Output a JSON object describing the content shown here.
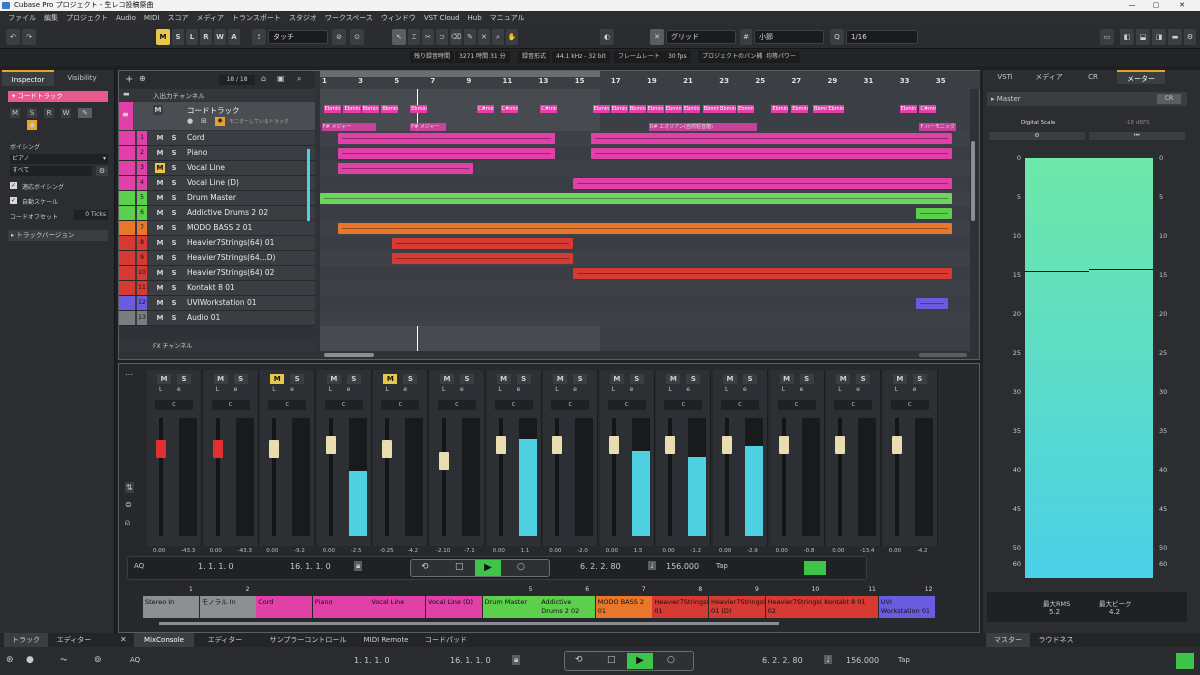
{
  "title_bar": {
    "text": "Cubase Pro プロジェクト - 生レコ投稿祭曲"
  },
  "menu": [
    "ファイル",
    "編集",
    "プロジェクト",
    "Audio",
    "MIDI",
    "スコア",
    "メディア",
    "トランスポート",
    "スタジオ",
    "ワークスペース",
    "ウィンドウ",
    "VST Cloud",
    "Hub",
    "マニュアル"
  ],
  "toolbar": {
    "m": "M",
    "s": "S",
    "l": "L",
    "r": "R",
    "w": "W",
    "a": "A",
    "automation_mode": "タッチ",
    "snap_type": "グリッド",
    "grid": "小節",
    "quantize": "1/16"
  },
  "status": {
    "rec_time_label": "残り録音時間",
    "rec_time": "3271 時間 31 分",
    "rec_format_label": "録音形式",
    "rec_format": "44.1 kHz - 32 bit",
    "frame_rate_label": "フレームレート",
    "frame_rate": "30 fps",
    "pan_law_label": "プロジェクトのパン補正",
    "pan_law": "均等パワー"
  },
  "inspector": {
    "tab_inspector": "Inspector",
    "tab_visibility": "Visibility",
    "section": "コードトラック",
    "voicing_label": "ボイシング",
    "voicing": "ピアノ",
    "voicing_sub": "すべて",
    "adaptive_voicing": "適応ボイシング",
    "auto_scale": "自動スケール",
    "offset_label": "コードオフセット",
    "offset": "0 Ticks",
    "track_versions": "トラックバージョン"
  },
  "project": {
    "counter": "18 / 18",
    "input_channel": "入出力チャンネル",
    "chord_track": "コードトラック",
    "chord_monitor": "モニターしているトラック",
    "fx_channel": "FX チャンネル",
    "ruler": [
      "1",
      "3",
      "5",
      "7",
      "9",
      "11",
      "13",
      "15",
      "17",
      "19",
      "21",
      "23",
      "25",
      "27",
      "29",
      "31",
      "33",
      "35"
    ],
    "chords_row1": [
      "Ebmin",
      "Ebmin",
      "Bbmin",
      "Bbmin",
      "Ebmin",
      "C#min",
      "C#min",
      "C#min",
      "Ebmin",
      "Ebmin",
      "Bbmin",
      "Ebmin",
      "Ebmin",
      "Ebmin",
      "Bbmin",
      "Bbmin",
      "Ebmin",
      "Ebmin",
      "Ebmin",
      "Bbmin",
      "Ebmin",
      "Ebmin",
      "C#min"
    ],
    "scales": [
      "F# メジャー",
      "F# メジャー",
      "D# エオリアン(自然短音階)",
      "F ハーモニック"
    ],
    "tracks": [
      {
        "num": "1",
        "name": "Cord",
        "color": "#e040a8"
      },
      {
        "num": "2",
        "name": "Piano",
        "color": "#e040a8"
      },
      {
        "num": "3",
        "name": "Vocal Line",
        "color": "#e040a8"
      },
      {
        "num": "4",
        "name": "Vocal Line (D)",
        "color": "#e040a8"
      },
      {
        "num": "5",
        "name": "Drum Master",
        "color": "#5ccf4c"
      },
      {
        "num": "6",
        "name": "Addictive Drums 2 02",
        "color": "#5ccf4c"
      },
      {
        "num": "7",
        "name": "MODO BASS 2 01",
        "color": "#e8772c"
      },
      {
        "num": "8",
        "name": "Heavier7Strings(64) 01",
        "color": "#d63a32"
      },
      {
        "num": "9",
        "name": "Heavier7Strings(64...D)",
        "color": "#d63a32"
      },
      {
        "num": "10",
        "name": "Heavier7Strings(64) 02",
        "color": "#d63a32"
      },
      {
        "num": "11",
        "name": "Kontakt 8 01",
        "color": "#d63a32"
      },
      {
        "num": "12",
        "name": "UVIWorkstation 01",
        "color": "#6a5ce0"
      },
      {
        "num": "13",
        "name": "Audio 01",
        "color": "#7a7d82"
      }
    ]
  },
  "mixer": {
    "channels": [
      {
        "num": "1",
        "name": "Stereo In",
        "color": "#8c8f93",
        "val1": "0.00",
        "val2": "-43.3",
        "meter": 0.0
      },
      {
        "num": "2",
        "name": "モノラル In",
        "color": "#8c8f93",
        "val1": "0.00",
        "val2": "-43.3",
        "meter": 0.0
      },
      {
        "num": "",
        "name": "Cord",
        "color": "#e040a8",
        "val1": "0.00",
        "val2": "-9.2",
        "meter": 0.0
      },
      {
        "num": "",
        "name": "Piano",
        "color": "#e040a8",
        "val1": "0.00",
        "val2": "-2.5",
        "meter": 0.55
      },
      {
        "num": "",
        "name": "Vocal Line",
        "color": "#e040a8",
        "val1": "-0.25",
        "val2": "-4.2",
        "meter": 0.0
      },
      {
        "num": "",
        "name": "Vocal Line (D)",
        "color": "#e040a8",
        "val1": "-2.10",
        "val2": "-7.1",
        "meter": 0.0
      },
      {
        "num": "5",
        "name": "Drum Master",
        "color": "#5ccf4c",
        "val1": "0.00",
        "val2": "1.1",
        "meter": 0.82
      },
      {
        "num": "6",
        "name": "Addictive Drums 2 02",
        "color": "#5ccf4c",
        "val1": "0.00",
        "val2": "-2.0",
        "meter": 0.0
      },
      {
        "num": "7",
        "name": "MODO BASS 2 01",
        "color": "#e8772c",
        "val1": "0.00",
        "val2": "1.5",
        "meter": 0.72
      },
      {
        "num": "8",
        "name": "Heavier7Strings(64) 01",
        "color": "#d63a32",
        "val1": "0.00",
        "val2": "-1.2",
        "meter": 0.67
      },
      {
        "num": "9",
        "name": "Heavier7Strings(64) 01 (D)",
        "color": "#d63a32",
        "val1": "0.00",
        "val2": "-2.9",
        "meter": 0.76
      },
      {
        "num": "10",
        "name": "Heavier7Strings(64) 02",
        "color": "#d63a32",
        "val1": "0.00",
        "val2": "-0.8",
        "meter": 0.0
      },
      {
        "num": "11",
        "name": "Kontakt 8 01",
        "color": "#d63a32",
        "val1": "0.00",
        "val2": "-13.4",
        "meter": 0.0
      },
      {
        "num": "12",
        "name": "UVI Workstation 01",
        "color": "#6a5ce0",
        "val1": "0.00",
        "val2": "-4.2",
        "meter": 0.0
      }
    ],
    "transport": {
      "aq": "AQ",
      "left": "1. 1. 1.  0",
      "right": "16. 1. 1.  0",
      "pos": "6. 2. 2. 80",
      "tempo": "156.000",
      "tap": "Tap"
    }
  },
  "right_panel": {
    "tabs": [
      "VSTi",
      "メディア",
      "CR",
      "メーター"
    ],
    "master": "Master",
    "cr": "CR",
    "scale": "Digital Scale",
    "ref": "-18 dBFS",
    "ticks": [
      "0",
      "5",
      "10",
      "15",
      "20",
      "25",
      "30",
      "35",
      "40",
      "45",
      "50",
      "60"
    ],
    "max_rms_label": "最大RMS",
    "max_rms": "5.2",
    "max_peak_label": "最大ピーク",
    "max_peak": "4.2",
    "bottom_tabs": [
      "マスター",
      "ラウドネス"
    ]
  },
  "bottom_tabs": [
    "トラック",
    "エディター",
    "MixConsole",
    "エディター",
    "サンプラーコントロール",
    "MIDI Remote",
    "コードパッド"
  ],
  "transport": {
    "aq": "AQ",
    "left": "1. 1. 1.  0",
    "right": "16. 1. 1.  0",
    "pos": "6. 2. 2. 80",
    "tempo": "156.000",
    "tap": "Tap"
  }
}
